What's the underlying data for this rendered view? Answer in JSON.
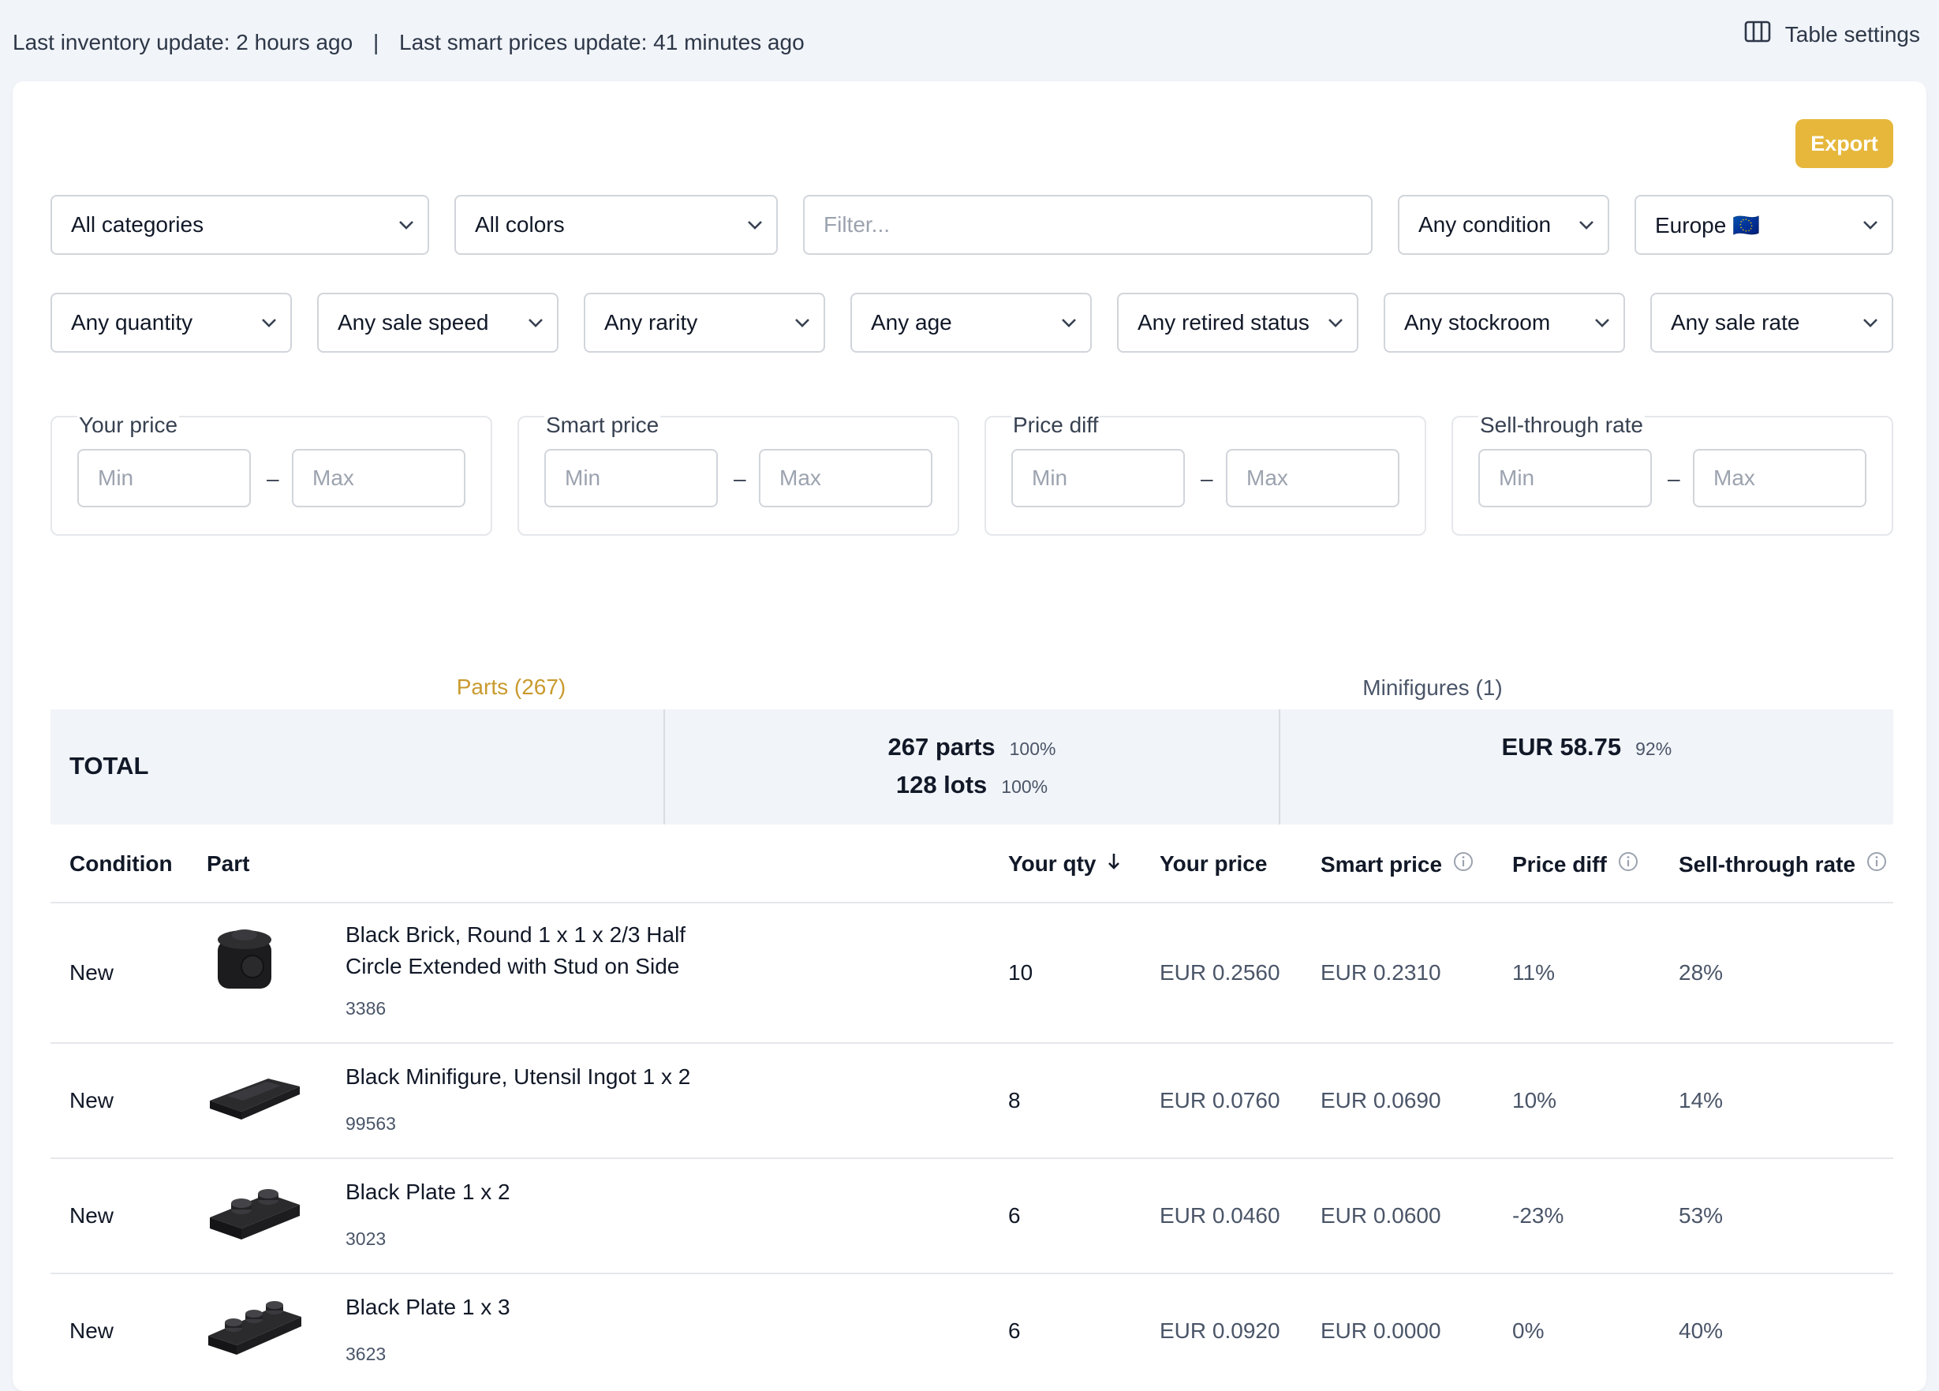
{
  "status": {
    "inventory_update": "Last inventory update: 2 hours ago",
    "separator": "|",
    "smart_prices_update": "Last smart prices update: 41 minutes ago",
    "table_settings": "Table settings"
  },
  "export_label": "Export",
  "filters": {
    "row1": {
      "categories": "All categories",
      "colors": "All colors",
      "filter_placeholder": "Filter...",
      "condition": "Any condition",
      "region": "Europe 🇪🇺"
    },
    "row2": {
      "quantity": "Any quantity",
      "sale_speed": "Any sale speed",
      "rarity": "Any rarity",
      "age": "Any age",
      "retired_status": "Any retired status",
      "stockroom": "Any stockroom",
      "sale_rate": "Any sale rate"
    },
    "ranges": [
      {
        "label": "Your price",
        "min": "Min",
        "max": "Max"
      },
      {
        "label": "Smart price",
        "min": "Min",
        "max": "Max"
      },
      {
        "label": "Price diff",
        "min": "Min",
        "max": "Max"
      },
      {
        "label": "Sell-through rate",
        "min": "Min",
        "max": "Max"
      }
    ]
  },
  "tabs": [
    {
      "label": "Parts (267)",
      "active": true
    },
    {
      "label": "Minifigures (1)",
      "active": false
    }
  ],
  "totals": {
    "label": "TOTAL",
    "parts": "267 parts",
    "parts_pct": "100%",
    "lots": "128 lots",
    "lots_pct": "100%",
    "value": "EUR 58.75",
    "value_pct": "92%"
  },
  "table": {
    "headers": {
      "condition": "Condition",
      "part": "Part",
      "your_qty": "Your qty",
      "your_price": "Your price",
      "smart_price": "Smart price",
      "price_diff": "Price diff",
      "sell_through": "Sell-through rate"
    },
    "rows": [
      {
        "condition": "New",
        "name": "Black Brick, Round 1 x 1 x 2/3 Half Circle Extended with Stud on Side",
        "id": "3386",
        "qty": "10",
        "your_price": "EUR 0.2560",
        "smart_price": "EUR 0.2310",
        "price_diff": "11%",
        "sell_through": "28%",
        "image": "round-brick"
      },
      {
        "condition": "New",
        "name": "Black Minifigure, Utensil Ingot 1 x 2",
        "id": "99563",
        "qty": "8",
        "your_price": "EUR 0.0760",
        "smart_price": "EUR 0.0690",
        "price_diff": "10%",
        "sell_through": "14%",
        "image": "ingot"
      },
      {
        "condition": "New",
        "name": "Black Plate 1 x 2",
        "id": "3023",
        "qty": "6",
        "your_price": "EUR 0.0460",
        "smart_price": "EUR 0.0600",
        "price_diff": "-23%",
        "sell_through": "53%",
        "image": "plate-1x2"
      },
      {
        "condition": "New",
        "name": "Black Plate 1 x 3",
        "id": "3623",
        "qty": "6",
        "your_price": "EUR 0.0920",
        "smart_price": "EUR 0.0000",
        "price_diff": "0%",
        "sell_through": "40%",
        "image": "plate-1x3"
      }
    ]
  },
  "colors": {
    "accent": "#e6b73b",
    "active_tab_text": "#c99a2e",
    "background": "#f1f4f8"
  }
}
